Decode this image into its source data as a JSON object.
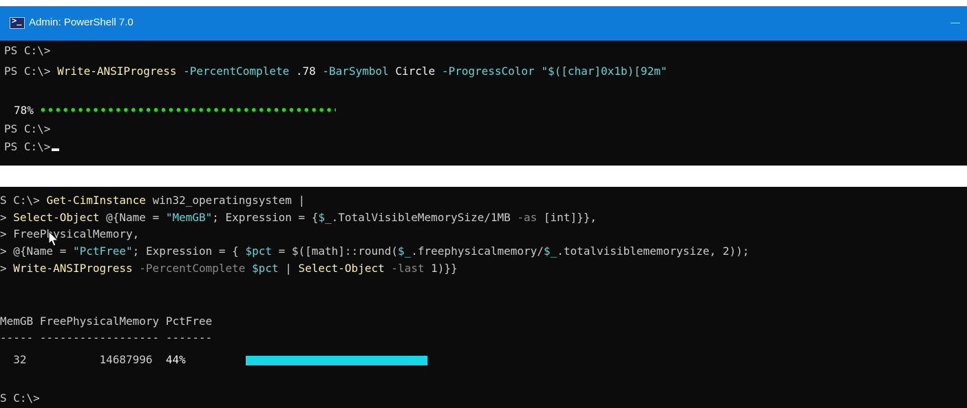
{
  "window1": {
    "title": "Admin: PowerShell 7.0",
    "prompt": "PS C:\\> ",
    "line1": "PS C:\\>",
    "cmd": "Write-ANSIProgress",
    "p1": "-PercentComplete",
    "v1": ".78",
    "p2": "-BarSymbol",
    "v2": "Circle",
    "p3": "-ProgressColor",
    "v3a": "\"$([char]0x1b)",
    "v3b": "[92m\"",
    "percent_label": "78%",
    "progress": 0.78,
    "line_after1": "PS C:\\>",
    "line_after2": "PS C:\\>"
  },
  "window2": {
    "l1_prompt": "S C:\\> ",
    "l1_cmd": "Get-CimInstance",
    "l1_rest": " win32_operatingsystem |",
    "l2_pre": "> ",
    "l2_cmd": "Select-Object",
    "l2_a": " @{Name = ",
    "l2_str": "\"MemGB\"",
    "l2_b": "; Expression = {",
    "l2_var": "$_",
    "l2_c": ".TotalVisibleMemorySize/1MB ",
    "l2_op": "-as",
    "l2_d": " [int]}},",
    "l3_pre": "> ",
    "l3_text": "FreePhysicalMemory,",
    "l4_pre": "> ",
    "l4_a": "@{Name = ",
    "l4_str": "\"PctFree\"",
    "l4_b": "; Expression = { ",
    "l4_var1": "$pct",
    "l4_c": " = $([math]::round(",
    "l4_var2": "$_",
    "l4_d": ".freephysicalmemory/",
    "l4_var3": "$_",
    "l4_e": ".totalvisiblememorysize, 2));",
    "l5_pre": "> ",
    "l5_cmd": "Write-ANSIProgress",
    "l5_p1": " -PercentComplete ",
    "l5_var": "$pct",
    "l5_a": " | ",
    "l5_cmd2": "Select-Object",
    "l5_p2": " -last",
    "l5_b": " 1)}}",
    "headers": "MemGB FreePhysicalMemory PctFree",
    "separator": "----- ------------------ -------",
    "row_memgb": "32",
    "row_free": "14687996",
    "row_pct": "44%",
    "bar_fraction": 0.44,
    "final_prompt": "S C:\\>"
  },
  "colors": {
    "titlebar": "#0f7bd8",
    "console_bg": "#0c0c0c",
    "command": "#f9f1a5",
    "parameter": "#8a8a8a",
    "variable": "#61d6d6",
    "string": "#61d6d6",
    "green_progress": "#16e60c",
    "cyan_bar": "#13d8e8"
  },
  "icons": {
    "app": "powershell-icon",
    "pointer": "mouse-pointer-icon"
  }
}
